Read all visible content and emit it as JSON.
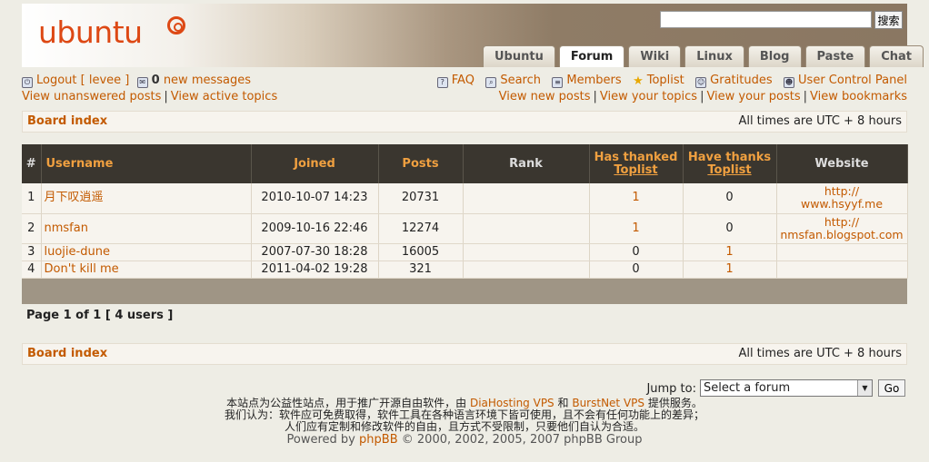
{
  "header": {
    "logo_text": "ubuntu",
    "search": {
      "value": "",
      "button_label": "搜索"
    },
    "tabs": [
      {
        "label": "Ubuntu",
        "active": false
      },
      {
        "label": "Forum",
        "active": true
      },
      {
        "label": "Wiki",
        "active": false
      },
      {
        "label": "Linux",
        "active": false
      },
      {
        "label": "Blog",
        "active": false
      },
      {
        "label": "Paste",
        "active": false
      },
      {
        "label": "Chat",
        "active": false
      }
    ]
  },
  "user_links": {
    "logout": "Logout [ levee ]",
    "messages_count": "0",
    "messages_label": "new messages",
    "unanswered": "View unanswered posts",
    "active": "View active topics",
    "faq": "FAQ",
    "search": "Search",
    "members": "Members",
    "toplist": "Toplist",
    "gratitudes": "Gratitudes",
    "ucp": "User Control Panel",
    "new_posts": "View new posts",
    "your_topics": "View your topics",
    "your_posts": "View your posts",
    "bookmarks": "View bookmarks",
    "separator": "|"
  },
  "breadcrumb": {
    "board_index": "Board index",
    "timezone": "All times are UTC + 8 hours"
  },
  "table": {
    "headers": {
      "num": "#",
      "username": "Username",
      "joined": "Joined",
      "posts": "Posts",
      "rank": "Rank",
      "has_thanked_1": "Has thanked",
      "has_thanked_2": "Toplist",
      "have_thanks_1": "Have thanks",
      "have_thanks_2": "Toplist",
      "website": "Website"
    },
    "rows": [
      {
        "num": "1",
        "username": "月下叹逍遥",
        "joined": "2010-10-07 14:23",
        "posts": "20731",
        "rank": "",
        "thanked": "1",
        "thanks": "0",
        "website_1": "http://",
        "website_2": "www.hsyyf.me"
      },
      {
        "num": "2",
        "username": "nmsfan",
        "joined": "2009-10-16 22:46",
        "posts": "12274",
        "rank": "",
        "thanked": "1",
        "thanks": "0",
        "website_1": "http://",
        "website_2": "nmsfan.blogspot.com"
      },
      {
        "num": "3",
        "username": "luojie-dune",
        "joined": "2007-07-30 18:28",
        "posts": "16005",
        "rank": "",
        "thanked": "0",
        "thanks": "1",
        "website_1": "",
        "website_2": ""
      },
      {
        "num": "4",
        "username": "Don't kill me",
        "joined": "2011-04-02 19:28",
        "posts": "321",
        "rank": "",
        "thanked": "0",
        "thanks": "1",
        "website_1": "",
        "website_2": ""
      }
    ]
  },
  "pagination": "Page 1 of 1 [ 4 users ]",
  "jump": {
    "label": "Jump to:",
    "selected": "Select a forum",
    "go_label": "Go"
  },
  "footer": {
    "line1_a": "本站点为公益性站点，用于推广开源自由软件，由",
    "line1_link1": "DiaHosting VPS",
    "line1_and": "和",
    "line1_link2": "BurstNet VPS",
    "line1_b": "提供服务。",
    "line2": "我们认为：软件应可免费取得，软件工具在各种语言环境下皆可使用，且不会有任何功能上的差异；",
    "line3": "人们应有定制和修改软件的自由，且方式不受限制，只要他们自认为合适。",
    "powered_a": "Powered by",
    "powered_link": "phpBB",
    "powered_b": "© 2000, 2002, 2005, 2007 phpBB Group"
  },
  "colors": {
    "accent": "#c35a00",
    "header_dark": "#3a362f",
    "logo": "#dd4814"
  }
}
